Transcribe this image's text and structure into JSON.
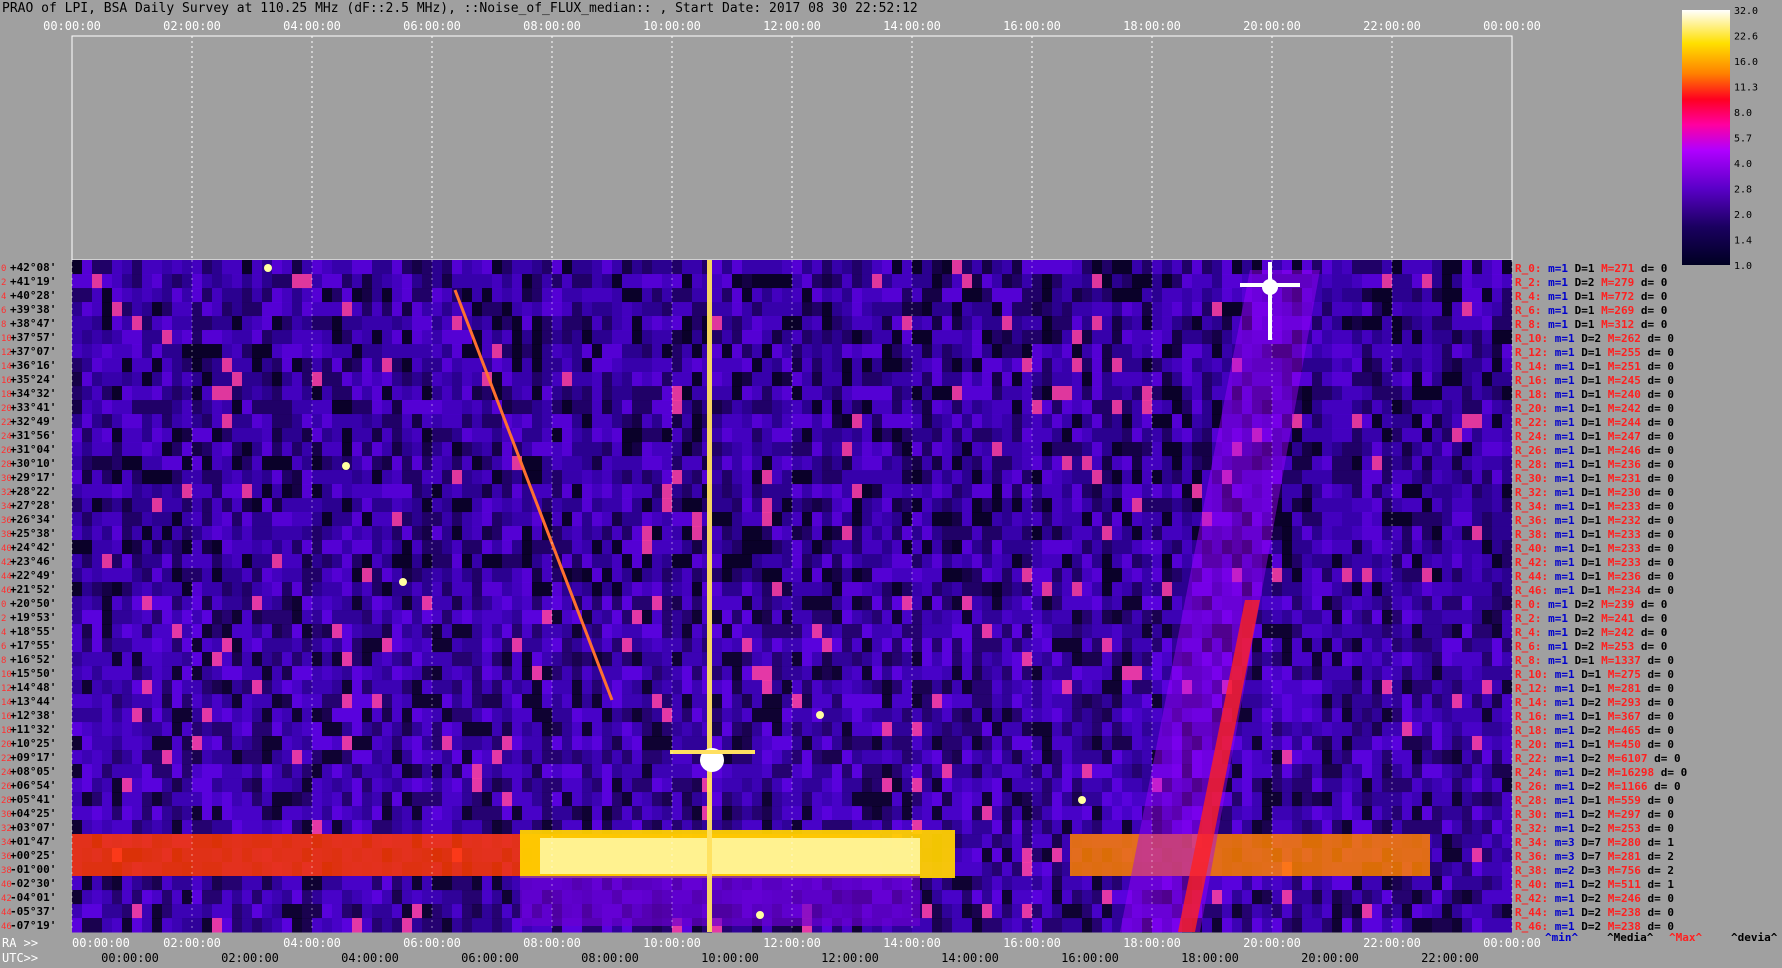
{
  "title": "PRAO of LPI, BSA Daily Survey at 110.25 MHz (dF::2.5 MHz), ::Noise_of_FLUX_median:: , Start Date: 2017 08 30 22:52:12",
  "colors": {
    "background": "#a0a0a0",
    "low": "#000033",
    "mid": "#8a00ff",
    "high": "#ffffff",
    "stat_label": "#ff2020",
    "stat_blue": "#0000cc"
  },
  "top_axis_ticks": [
    "00:00:00",
    "02:00:00",
    "04:00:00",
    "06:00:00",
    "08:00:00",
    "10:00:00",
    "12:00:00",
    "14:00:00",
    "16:00:00",
    "18:00:00",
    "20:00:00",
    "22:00:00",
    "00:00:00"
  ],
  "ra_axis": {
    "label": "RA >>",
    "ticks": [
      "00:00:00",
      "02:00:00",
      "04:00:00",
      "06:00:00",
      "08:00:00",
      "10:00:00",
      "12:00:00",
      "14:00:00",
      "16:00:00",
      "18:00:00",
      "20:00:00",
      "22:00:00",
      "00:00:00"
    ]
  },
  "utc_axis": {
    "label": "UTC>>",
    "ticks": [
      "00:00:00",
      "02:00:00",
      "04:00:00",
      "06:00:00",
      "08:00:00",
      "10:00:00",
      "12:00:00",
      "14:00:00",
      "16:00:00",
      "18:00:00",
      "20:00:00",
      "22:00:00"
    ]
  },
  "legend_footer": [
    "^min^",
    "^Media^",
    "^Max^",
    "^devia^"
  ],
  "colorbar": {
    "ticks": [
      "32.0",
      "22.6",
      "16.0",
      "11.3",
      "8.0",
      "5.7",
      "4.0",
      "2.8",
      "2.0",
      "1.4",
      "1.0"
    ]
  },
  "chart_data": {
    "type": "heatmap",
    "title": "PRAO of LPI, BSA Daily Survey at 110.25 MHz (dF::2.5 MHz), ::Noise_of_FLUX_median:: , Start Date: 2017 08 30 22:52:12",
    "x_range": [
      "00:00:00",
      "24:00:00"
    ],
    "color_scale": [
      1.0,
      32.0
    ],
    "declinations": [
      "+42°08'",
      "+41°19'",
      "+40°28'",
      "+39°38'",
      "+38°47'",
      "+37°57'",
      "+37°07'",
      "+36°16'",
      "+35°24'",
      "+34°32'",
      "+33°41'",
      "+32°49'",
      "+31°56'",
      "+31°04'",
      "+30°10'",
      "+29°17'",
      "+28°22'",
      "+27°28'",
      "+26°34'",
      "+25°38'",
      "+24°42'",
      "+23°46'",
      "+22°49'",
      "+21°52'",
      "+20°50'",
      "+19°53'",
      "+18°55'",
      "+17°55'",
      "+16°52'",
      "+15°50'",
      "+14°48'",
      "+13°44'",
      "+12°38'",
      "+11°32'",
      "+10°25'",
      "+09°17'",
      "+08°05'",
      "+06°54'",
      "+05°41'",
      "+04°25'",
      "+03°07'",
      "+01°47'",
      "+00°25'",
      "-01°00'",
      "-02°30'",
      "-04°01'",
      "-05°37'",
      "-07°19'"
    ],
    "row_indices": [
      "0",
      "2",
      "4",
      "6",
      "8",
      "10",
      "12",
      "14",
      "16",
      "18",
      "20",
      "22",
      "24",
      "26",
      "28",
      "30",
      "32",
      "34",
      "36",
      "38",
      "40",
      "42",
      "44",
      "46",
      "0",
      "2",
      "4",
      "6",
      "8",
      "10",
      "12",
      "14",
      "16",
      "18",
      "20",
      "22",
      "24",
      "26",
      "28",
      "30",
      "32",
      "34",
      "36",
      "38",
      "40",
      "42",
      "44",
      "46"
    ],
    "row_stats": [
      {
        "r": "R_0:",
        "m": "m=1",
        "D": "D=1",
        "M": "M=271",
        "d": "d= 0"
      },
      {
        "r": "R_2:",
        "m": "m=1",
        "D": "D=2",
        "M": "M=279",
        "d": "d= 0"
      },
      {
        "r": "R_4:",
        "m": "m=1",
        "D": "D=1",
        "M": "M=772",
        "d": "d= 0"
      },
      {
        "r": "R_6:",
        "m": "m=1",
        "D": "D=1",
        "M": "M=269",
        "d": "d= 0"
      },
      {
        "r": "R_8:",
        "m": "m=1",
        "D": "D=1",
        "M": "M=312",
        "d": "d= 0"
      },
      {
        "r": "R_10:",
        "m": "m=1",
        "D": "D=2",
        "M": "M=262",
        "d": "d= 0"
      },
      {
        "r": "R_12:",
        "m": "m=1",
        "D": "D=1",
        "M": "M=255",
        "d": "d= 0"
      },
      {
        "r": "R_14:",
        "m": "m=1",
        "D": "D=1",
        "M": "M=251",
        "d": "d= 0"
      },
      {
        "r": "R_16:",
        "m": "m=1",
        "D": "D=1",
        "M": "M=245",
        "d": "d= 0"
      },
      {
        "r": "R_18:",
        "m": "m=1",
        "D": "D=1",
        "M": "M=240",
        "d": "d= 0"
      },
      {
        "r": "R_20:",
        "m": "m=1",
        "D": "D=1",
        "M": "M=242",
        "d": "d= 0"
      },
      {
        "r": "R_22:",
        "m": "m=1",
        "D": "D=1",
        "M": "M=244",
        "d": "d= 0"
      },
      {
        "r": "R_24:",
        "m": "m=1",
        "D": "D=1",
        "M": "M=247",
        "d": "d= 0"
      },
      {
        "r": "R_26:",
        "m": "m=1",
        "D": "D=1",
        "M": "M=246",
        "d": "d= 0"
      },
      {
        "r": "R_28:",
        "m": "m=1",
        "D": "D=1",
        "M": "M=236",
        "d": "d= 0"
      },
      {
        "r": "R_30:",
        "m": "m=1",
        "D": "D=1",
        "M": "M=231",
        "d": "d= 0"
      },
      {
        "r": "R_32:",
        "m": "m=1",
        "D": "D=1",
        "M": "M=230",
        "d": "d= 0"
      },
      {
        "r": "R_34:",
        "m": "m=1",
        "D": "D=1",
        "M": "M=233",
        "d": "d= 0"
      },
      {
        "r": "R_36:",
        "m": "m=1",
        "D": "D=1",
        "M": "M=232",
        "d": "d= 0"
      },
      {
        "r": "R_38:",
        "m": "m=1",
        "D": "D=1",
        "M": "M=233",
        "d": "d= 0"
      },
      {
        "r": "R_40:",
        "m": "m=1",
        "D": "D=1",
        "M": "M=233",
        "d": "d= 0"
      },
      {
        "r": "R_42:",
        "m": "m=1",
        "D": "D=1",
        "M": "M=233",
        "d": "d= 0"
      },
      {
        "r": "R_44:",
        "m": "m=1",
        "D": "D=1",
        "M": "M=236",
        "d": "d= 0"
      },
      {
        "r": "R_46:",
        "m": "m=1",
        "D": "D=1",
        "M": "M=234",
        "d": "d= 0"
      },
      {
        "r": "R_0:",
        "m": "m=1",
        "D": "D=2",
        "M": "M=239",
        "d": "d= 0"
      },
      {
        "r": "R_2:",
        "m": "m=1",
        "D": "D=2",
        "M": "M=241",
        "d": "d= 0"
      },
      {
        "r": "R_4:",
        "m": "m=1",
        "D": "D=2",
        "M": "M=242",
        "d": "d= 0"
      },
      {
        "r": "R_6:",
        "m": "m=1",
        "D": "D=2",
        "M": "M=253",
        "d": "d= 0"
      },
      {
        "r": "R_8:",
        "m": "m=1",
        "D": "D=1",
        "M": "M=1337",
        "d": "d= 0"
      },
      {
        "r": "R_10:",
        "m": "m=1",
        "D": "D=1",
        "M": "M=275",
        "d": "d= 0"
      },
      {
        "r": "R_12:",
        "m": "m=1",
        "D": "D=1",
        "M": "M=281",
        "d": "d= 0"
      },
      {
        "r": "R_14:",
        "m": "m=1",
        "D": "D=2",
        "M": "M=293",
        "d": "d= 0"
      },
      {
        "r": "R_16:",
        "m": "m=1",
        "D": "D=1",
        "M": "M=367",
        "d": "d= 0"
      },
      {
        "r": "R_18:",
        "m": "m=1",
        "D": "D=2",
        "M": "M=465",
        "d": "d= 0"
      },
      {
        "r": "R_20:",
        "m": "m=1",
        "D": "D=1",
        "M": "M=450",
        "d": "d= 0"
      },
      {
        "r": "R_22:",
        "m": "m=1",
        "D": "D=2",
        "M": "M=6107",
        "d": "d= 0"
      },
      {
        "r": "R_24:",
        "m": "m=1",
        "D": "D=2",
        "M": "M=16298",
        "d": "d= 0"
      },
      {
        "r": "R_26:",
        "m": "m=1",
        "D": "D=2",
        "M": "M=1166",
        "d": "d= 0"
      },
      {
        "r": "R_28:",
        "m": "m=1",
        "D": "D=1",
        "M": "M=559",
        "d": "d= 0"
      },
      {
        "r": "R_30:",
        "m": "m=1",
        "D": "D=2",
        "M": "M=297",
        "d": "d= 0"
      },
      {
        "r": "R_32:",
        "m": "m=1",
        "D": "D=2",
        "M": "M=253",
        "d": "d= 0"
      },
      {
        "r": "R_34:",
        "m": "m=3",
        "D": "D=7",
        "M": "M=280",
        "d": "d= 1"
      },
      {
        "r": "R_36:",
        "m": "m=3",
        "D": "D=7",
        "M": "M=281",
        "d": "d= 2"
      },
      {
        "r": "R_38:",
        "m": "m=2",
        "D": "D=3",
        "M": "M=756",
        "d": "d= 2"
      },
      {
        "r": "R_40:",
        "m": "m=1",
        "D": "D=2",
        "M": "M=511",
        "d": "d= 1"
      },
      {
        "r": "R_42:",
        "m": "m=1",
        "D": "D=2",
        "M": "M=246",
        "d": "d= 0"
      },
      {
        "r": "R_44:",
        "m": "m=1",
        "D": "D=2",
        "M": "M=238",
        "d": "d= 0"
      },
      {
        "r": "R_46:",
        "m": "m=1",
        "D": "D=2",
        "M": "M=238",
        "d": "d= 0"
      }
    ]
  }
}
